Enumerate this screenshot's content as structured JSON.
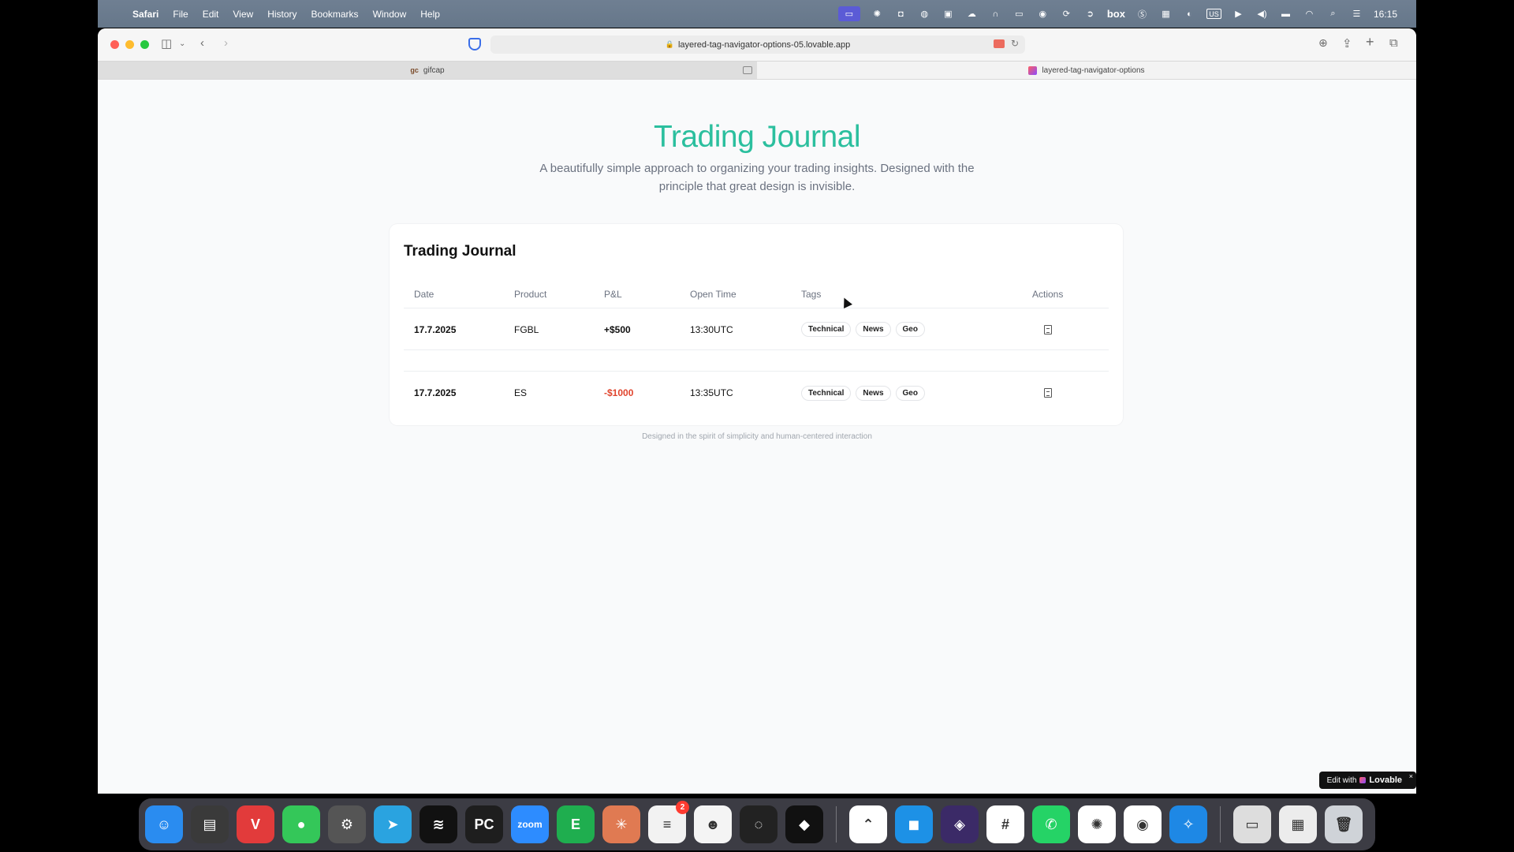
{
  "menubar": {
    "app": "Safari",
    "items": [
      "File",
      "Edit",
      "View",
      "History",
      "Bookmarks",
      "Window",
      "Help"
    ],
    "status_box_label": "box",
    "status_badge_label": "US",
    "time": "16:15"
  },
  "browser": {
    "url": "layered-tag-navigator-options-05.lovable.app",
    "tabs": [
      {
        "label": "gifcap",
        "favicon": "gc"
      },
      {
        "label": "layered-tag-navigator-options"
      }
    ]
  },
  "page": {
    "hero_title": "Trading Journal",
    "hero_subtitle": "A beautifully simple approach to organizing your trading insights. Designed with the principle that great design is invisible.",
    "card_title": "Trading Journal",
    "columns": {
      "date": "Date",
      "product": "Product",
      "pnl": "P&L",
      "open_time": "Open Time",
      "tags": "Tags",
      "actions": "Actions"
    },
    "rows": [
      {
        "date": "17.7.2025",
        "product": "FGBL",
        "pnl": "+$500",
        "open_time": "13:30UTC",
        "tags": [
          "Technical",
          "News",
          "Geo"
        ]
      },
      {
        "date": "17.7.2025",
        "product": "ES",
        "pnl": "-$1000",
        "open_time": "13:35UTC",
        "tags": [
          "Technical",
          "News",
          "Geo"
        ]
      }
    ],
    "footer_note": "Designed in the spirit of simplicity and human-centered interaction",
    "edit_badge": {
      "prefix": "Edit with",
      "brand": "Lovable",
      "close": "×"
    }
  },
  "colors": {
    "accent": "#2bbf9e",
    "negative": "#e0442d"
  },
  "dock": {
    "badge_count": "2",
    "apps": [
      {
        "name": "finder-icon",
        "glyph": "☺",
        "bg": "#2a8cf0"
      },
      {
        "name": "notes-icon",
        "glyph": "▤",
        "bg": "#3a3a3a"
      },
      {
        "name": "vivaldi-icon",
        "glyph": "V",
        "bg": "#e23b3b"
      },
      {
        "name": "messages-icon",
        "glyph": "●",
        "bg": "#34c759"
      },
      {
        "name": "system-settings-icon",
        "glyph": "⚙",
        "bg": "#555555"
      },
      {
        "name": "telegram-icon",
        "glyph": "➤",
        "bg": "#2aa3e0"
      },
      {
        "name": "spotify-icon",
        "glyph": "≋",
        "bg": "#111111"
      },
      {
        "name": "pycharm-icon",
        "glyph": "PC",
        "bg": "#1e1e1e"
      },
      {
        "name": "zoom-icon",
        "glyph": "zoom",
        "bg": "#2d8cff"
      },
      {
        "name": "evernote-icon",
        "glyph": "E",
        "bg": "#1fae4f"
      },
      {
        "name": "claude-icon",
        "glyph": "✳",
        "bg": "#e07a52"
      },
      {
        "name": "reminders-icon",
        "glyph": "≡",
        "bg": "#f2f2f2"
      },
      {
        "name": "ollama-icon",
        "glyph": "☻",
        "bg": "#f4f4f4"
      },
      {
        "name": "loader-icon",
        "glyph": "◌",
        "bg": "#222222"
      },
      {
        "name": "unity-icon",
        "glyph": "◆",
        "bg": "#111111"
      },
      {
        "name": "nordvpn-icon",
        "glyph": "⌃",
        "bg": "#ffffff"
      },
      {
        "name": "docker-icon",
        "glyph": "◼",
        "bg": "#1d91e6"
      },
      {
        "name": "obsidian-icon",
        "glyph": "◈",
        "bg": "#3b2a67"
      },
      {
        "name": "slack-icon",
        "glyph": "#",
        "bg": "#ffffff"
      },
      {
        "name": "whatsapp-icon",
        "glyph": "✆",
        "bg": "#25d366"
      },
      {
        "name": "chatgpt-icon",
        "glyph": "✺",
        "bg": "#ffffff"
      },
      {
        "name": "chrome-icon",
        "glyph": "◉",
        "bg": "#ffffff"
      },
      {
        "name": "safari-icon",
        "glyph": "✧",
        "bg": "#1e88e5"
      }
    ],
    "extras": [
      {
        "name": "downloads-stack-icon",
        "glyph": "▭",
        "bg": "#dddddd"
      },
      {
        "name": "screenshot-stack-icon",
        "glyph": "▦",
        "bg": "#ececec"
      },
      {
        "name": "trash-icon",
        "glyph": "🗑",
        "bg": "#cfd3d8"
      }
    ]
  }
}
